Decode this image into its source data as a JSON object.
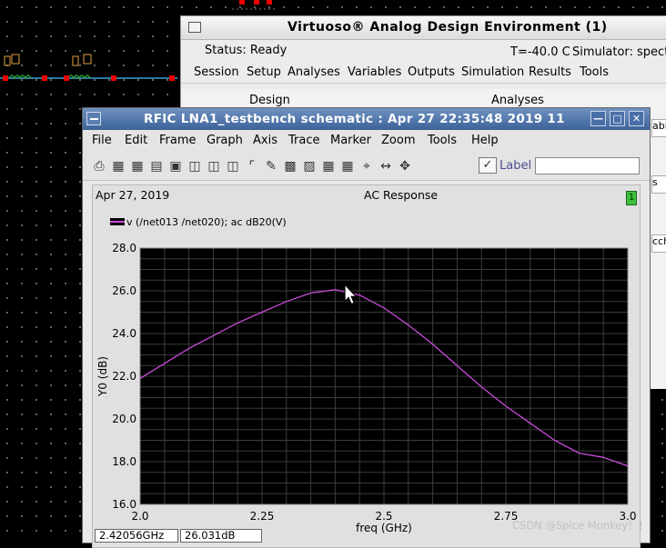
{
  "ade_window": {
    "title": "Virtuoso® Analog Design Environment (1)",
    "status": "Status: Ready",
    "temperature": "T=-40.0 C",
    "simulator": "Simulator: spectr",
    "menu": [
      "Session",
      "Setup",
      "Analyses",
      "Variables",
      "Outputs",
      "Simulation",
      "Results",
      "Tools"
    ],
    "panel_headers": [
      "Design",
      "Analyses"
    ],
    "right_fragments": [
      "abl",
      "s",
      "cch"
    ]
  },
  "waveform_window": {
    "title": "RFIC LNA1_testbench schematic : Apr 27 22:35:48 2019 11",
    "menu": [
      "File",
      "Edit",
      "Frame",
      "Graph",
      "Axis",
      "Trace",
      "Marker",
      "Zoom",
      "Tools",
      "Help"
    ],
    "toolbar_icons": [
      "print-icon",
      "print-preview-icon",
      "grid-icon",
      "strip-icon",
      "composite-icon",
      "zoom-in-icon",
      "zoom-fit-icon",
      "zoom-box-icon",
      "marker-icon",
      "annotate-icon",
      "log-x-icon",
      "log-y-icon",
      "bar-icon",
      "calculator-icon",
      "fit-icon",
      "pan-x-icon",
      "pan-xy-icon"
    ],
    "label_text": "Label",
    "label_value": "",
    "date": "Apr 27, 2019",
    "subwindow_number": "1",
    "cursor_readout": {
      "x": "2.42056GHz",
      "y": "26.031dB"
    }
  },
  "chart_data": {
    "type": "line",
    "title": "AC Response",
    "legend": [
      "v (/net013 /net020); ac dB20(V)"
    ],
    "xlabel": "freq (GHz)",
    "ylabel": "Y0 (dB)",
    "xlim": [
      2.0,
      3.0
    ],
    "ylim": [
      16.0,
      28.0
    ],
    "xticks": [
      "2.0",
      "2.25",
      "2.5",
      "2.75",
      "3.0"
    ],
    "yticks": [
      "16.0",
      "18.0",
      "20.0",
      "22.0",
      "24.0",
      "26.0",
      "28.0"
    ],
    "grid": true,
    "series": [
      {
        "name": "v (/net013 /net020); ac dB20(V)",
        "color": "#c84bd8",
        "x": [
          2.0,
          2.05,
          2.1,
          2.15,
          2.2,
          2.25,
          2.3,
          2.35,
          2.4,
          2.45,
          2.5,
          2.55,
          2.6,
          2.65,
          2.7,
          2.75,
          2.8,
          2.85,
          2.9,
          2.95,
          3.0
        ],
        "y": [
          21.9,
          22.6,
          23.3,
          23.9,
          24.5,
          25.0,
          25.5,
          25.9,
          26.05,
          25.8,
          25.2,
          24.4,
          23.5,
          22.5,
          21.5,
          20.6,
          19.8,
          19.0,
          18.4,
          18.2,
          17.8
        ]
      }
    ]
  },
  "watermark": "CSDN @Spice Monkey！！"
}
